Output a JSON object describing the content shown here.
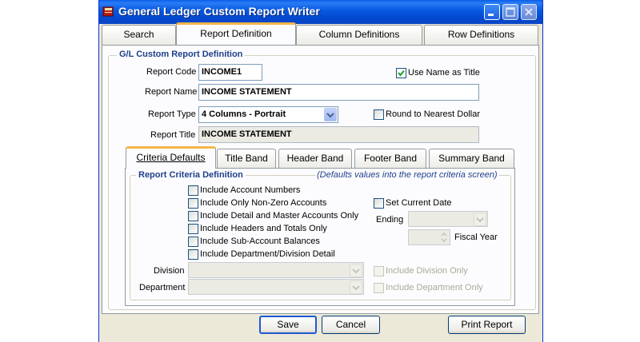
{
  "window": {
    "title": "General Ledger Custom Report Writer"
  },
  "tabs": [
    {
      "label": "Search"
    },
    {
      "label": "Report Definition"
    },
    {
      "label": "Column Definitions"
    },
    {
      "label": "Row Definitions"
    }
  ],
  "report_def": {
    "group_title": "G/L Custom Report Definition",
    "report_code_label": "Report Code",
    "report_code_value": "INCOME1",
    "use_name_as_title_label": "Use Name as Title",
    "use_name_as_title_checked": true,
    "report_name_label": "Report Name",
    "report_name_value": "INCOME STATEMENT",
    "report_type_label": "Report Type",
    "report_type_value": "4 Columns - Portrait",
    "round_label": "Round to Nearest Dollar",
    "report_title_label": "Report Title",
    "report_title_value": "INCOME STATEMENT"
  },
  "subtabs": [
    {
      "label": "Criteria Defaults"
    },
    {
      "label": "Title Band"
    },
    {
      "label": "Header Band"
    },
    {
      "label": "Footer Band"
    },
    {
      "label": "Summary Band"
    }
  ],
  "criteria": {
    "group_title": "Report Criteria Definition",
    "hint": "(Defaults values into the report criteria screen)",
    "checkboxes": [
      {
        "label": "Include Account Numbers",
        "checked": false
      },
      {
        "label": "Include Only Non-Zero Accounts",
        "checked": false
      },
      {
        "label": "Include Detail and Master Accounts Only",
        "checked": false
      },
      {
        "label": "Include Headers and Totals Only",
        "checked": false
      },
      {
        "label": "Include Sub-Account Balances",
        "checked": false
      },
      {
        "label": "Include Department/Division Detail",
        "checked": false
      }
    ],
    "set_current_date_label": "Set Current Date",
    "ending_label": "Ending",
    "fiscal_year_label": "Fiscal Year",
    "division_label": "Division",
    "department_label": "Department",
    "include_division_only_label": "Include Division Only",
    "include_department_only_label": "Include Department Only"
  },
  "buttons": {
    "save": "Save",
    "cancel": "Cancel",
    "print_report": "Print Report"
  }
}
